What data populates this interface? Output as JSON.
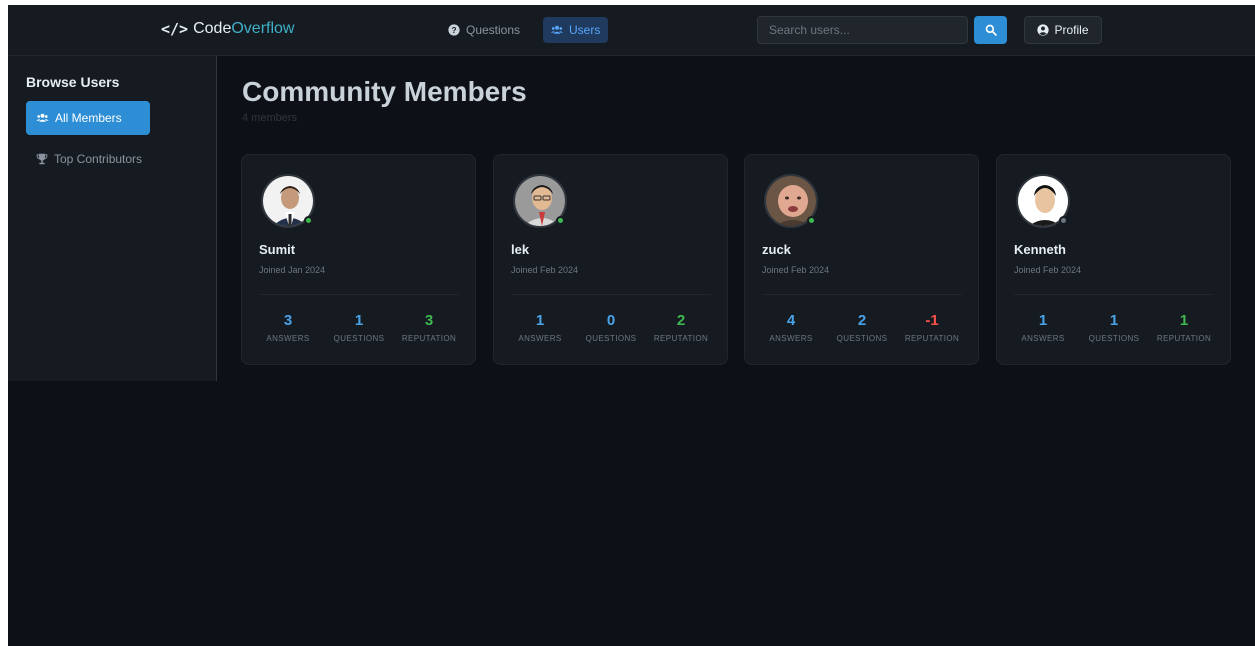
{
  "brand": {
    "code_glyph": "</>",
    "name_part1": "Code",
    "name_part2": "Overflow"
  },
  "nav": {
    "questions_label": "Questions",
    "users_label": "Users"
  },
  "search": {
    "placeholder": "Search users..."
  },
  "profile": {
    "label": "Profile"
  },
  "sidebar": {
    "title": "Browse Users",
    "items": [
      {
        "label": "All Members",
        "active": true,
        "icon": "users-icon"
      },
      {
        "label": "Top Contributors",
        "active": false,
        "icon": "trophy-icon"
      }
    ]
  },
  "main": {
    "title": "Community Members",
    "count": "4 members"
  },
  "stat_labels": {
    "answers": "ANSWERS",
    "questions": "QUESTIONS",
    "reputation": "REPUTATION"
  },
  "colors": {
    "accent": "#2d8ed6",
    "answers": "#4aa3e8",
    "questions": "#4aa3e8",
    "reputation_positive": "#3fb950",
    "reputation_negative": "#f85149",
    "online": "#3fb950",
    "offline": "#6e7681"
  },
  "members": [
    {
      "name": "Sumit",
      "joined": "Joined Jan 2024",
      "answers": "3",
      "questions": "1",
      "reputation": "3",
      "online": true
    },
    {
      "name": "lek",
      "joined": "Joined Feb 2024",
      "answers": "1",
      "questions": "0",
      "reputation": "2",
      "online": true
    },
    {
      "name": "zuck",
      "joined": "Joined Feb 2024",
      "answers": "4",
      "questions": "2",
      "reputation": "-1",
      "online": true
    },
    {
      "name": "Kenneth",
      "joined": "Joined Feb 2024",
      "answers": "1",
      "questions": "1",
      "reputation": "1",
      "online": false
    }
  ]
}
